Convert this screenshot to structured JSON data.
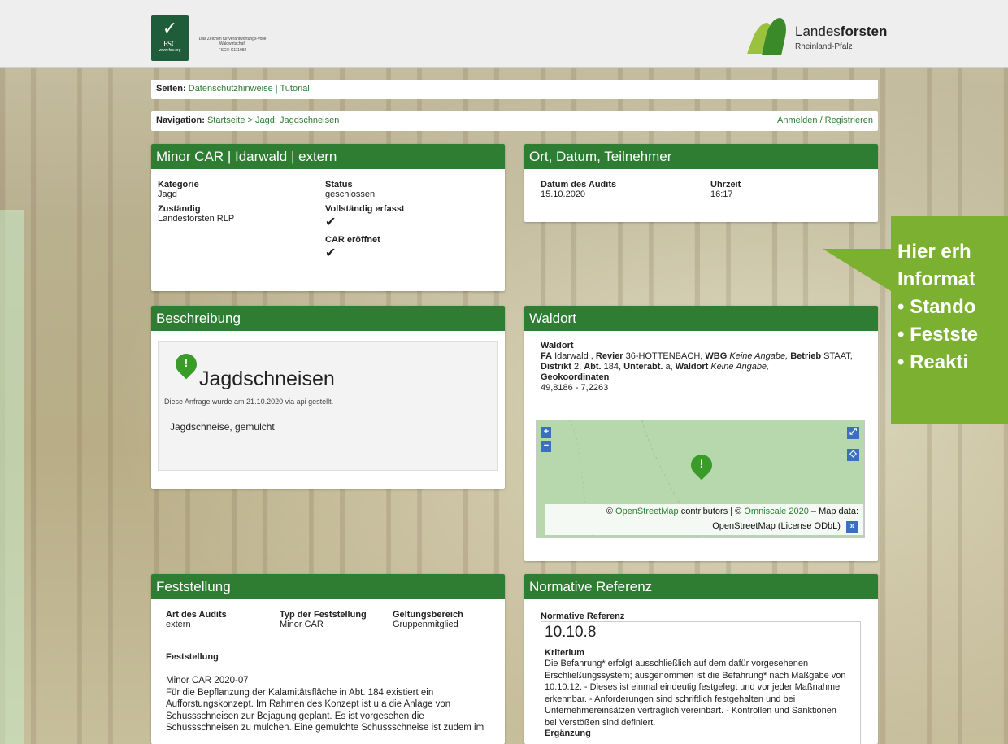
{
  "header": {
    "fsc": {
      "logo_text": "FSC",
      "web": "www.fsc.org",
      "tagline": "Das Zeichen für verantwortungs-volle Waldwirtschaft",
      "code": "FSC® C111982"
    },
    "brand": {
      "name_light": "Landes",
      "name_bold": "forsten",
      "sub": "Rheinland-Pfalz"
    }
  },
  "pages": {
    "label": "Seiten:",
    "links": [
      "Datenschutzhinweise",
      "Tutorial"
    ],
    "sep": "|"
  },
  "navigation": {
    "label": "Navigation:",
    "crumb_home": "Startseite",
    "crumb_sep": ">",
    "crumb_current": "Jagd: Jagdschneisen",
    "login": "Anmelden / Registrieren"
  },
  "car_panel": {
    "title": "Minor CAR | Idarwald | extern",
    "kategorie_label": "Kategorie",
    "kategorie_value": "Jagd",
    "status_label": "Status",
    "status_value": "geschlossen",
    "zustaendig_label": "Zuständig",
    "zustaendig_value": "Landesforsten RLP",
    "vollstaendig_label": "Vollständig erfasst",
    "car_label": "CAR eröffnet",
    "check_glyph": "✔"
  },
  "ort_panel": {
    "title": "Ort, Datum, Teilnehmer",
    "datum_label": "Datum des Audits",
    "datum_value": "15.10.2020",
    "uhrzeit_label": "Uhrzeit",
    "uhrzeit_value": "16:17"
  },
  "beschreibung_panel": {
    "title": "Beschreibung",
    "heading": "Jagdschneisen",
    "meta": "Diese Anfrage wurde am 21.10.2020 via api gestellt.",
    "text": "Jagdschneise, gemulcht"
  },
  "waldort_panel": {
    "title": "Waldort",
    "waldort_label": "Waldort",
    "fa_label": "FA",
    "fa_value": "Idarwald ,",
    "revier_label": "Revier",
    "revier_value": "36-HOTTENBACH,",
    "wbg_label": "WBG",
    "wbg_value": "Keine Angabe,",
    "betrieb_label": "Betrieb",
    "betrieb_value": "STAAT,",
    "distrikt_label": "Distrikt",
    "distrikt_value": "2,",
    "abt_label": "Abt.",
    "abt_value": "184,",
    "unterabt_label": "Unterabt.",
    "unterabt_value": "a,",
    "waldort2_label": "Waldort",
    "waldort2_value": "Keine Angabe,",
    "geo_label": "Geokoordinaten",
    "geo_value": "49,8186 - 7,2263",
    "map": {
      "zoom_in": "+",
      "zoom_out": "−",
      "attr_prefix": "©",
      "attr_osm": "OpenStreetMap",
      "attr_mid": "contributors | ©",
      "attr_omni": "Omniscale 2020",
      "attr_suffix": "– Map data:",
      "attr_line2": "OpenStreetMap (License ODbL)",
      "expand": "»"
    }
  },
  "feststellung_panel": {
    "title": "Feststellung",
    "art_label": "Art des Audits",
    "art_value": "extern",
    "typ_label": "Typ der Feststellung",
    "typ_value": "Minor CAR",
    "geltung_label": "Geltungsbereich",
    "geltung_value": "Gruppenmitglied",
    "fest_label": "Feststellung",
    "fest_lines": [
      "Minor CAR 2020-07",
      "Für die Bepflanzung der Kalamitätsfläche in Abt. 184 existiert ein",
      "Aufforstungskonzept. Im Rahmen des Konzept ist u.a die Anlage von",
      "Schussschneisen zur Bejagung geplant. Es ist vorgesehen die",
      "Schussschneisen zu mulchen. Eine gemulchte Schussschneise ist zudem im"
    ]
  },
  "normative_panel": {
    "title": "Normative Referenz",
    "ref_label": "Normative Referenz",
    "ref_value": "10.10.8",
    "kriterium_label": "Kriterium",
    "kriterium_lines": [
      "Die Befahrung* erfolgt ausschließlich auf dem dafür vorgesehenen",
      "Erschließungssystem; ausgenommen ist die Befahrung* nach Maßgabe von",
      "10.10.12. - Dieses ist einmal eindeutig festgelegt und vor jeder Maßnahme",
      "erkennbar. - Anforderungen sind schriftlich festgehalten und bei",
      "Unternehmereinsätzen vertraglich vereinbart. - Kontrollen und Sanktionen",
      "bei Verstößen sind definiert."
    ],
    "ergaenzung_label": "Ergänzung"
  },
  "callout": {
    "lines": [
      "Hier erh",
      "Informat",
      "• Stando",
      "• Festste",
      "• Reakti"
    ]
  },
  "colors": {
    "brand_green": "#2e7d32",
    "callout_green": "#7bb031",
    "map_green": "#b7d8ad",
    "zoom_blue": "#3b6fc1"
  }
}
